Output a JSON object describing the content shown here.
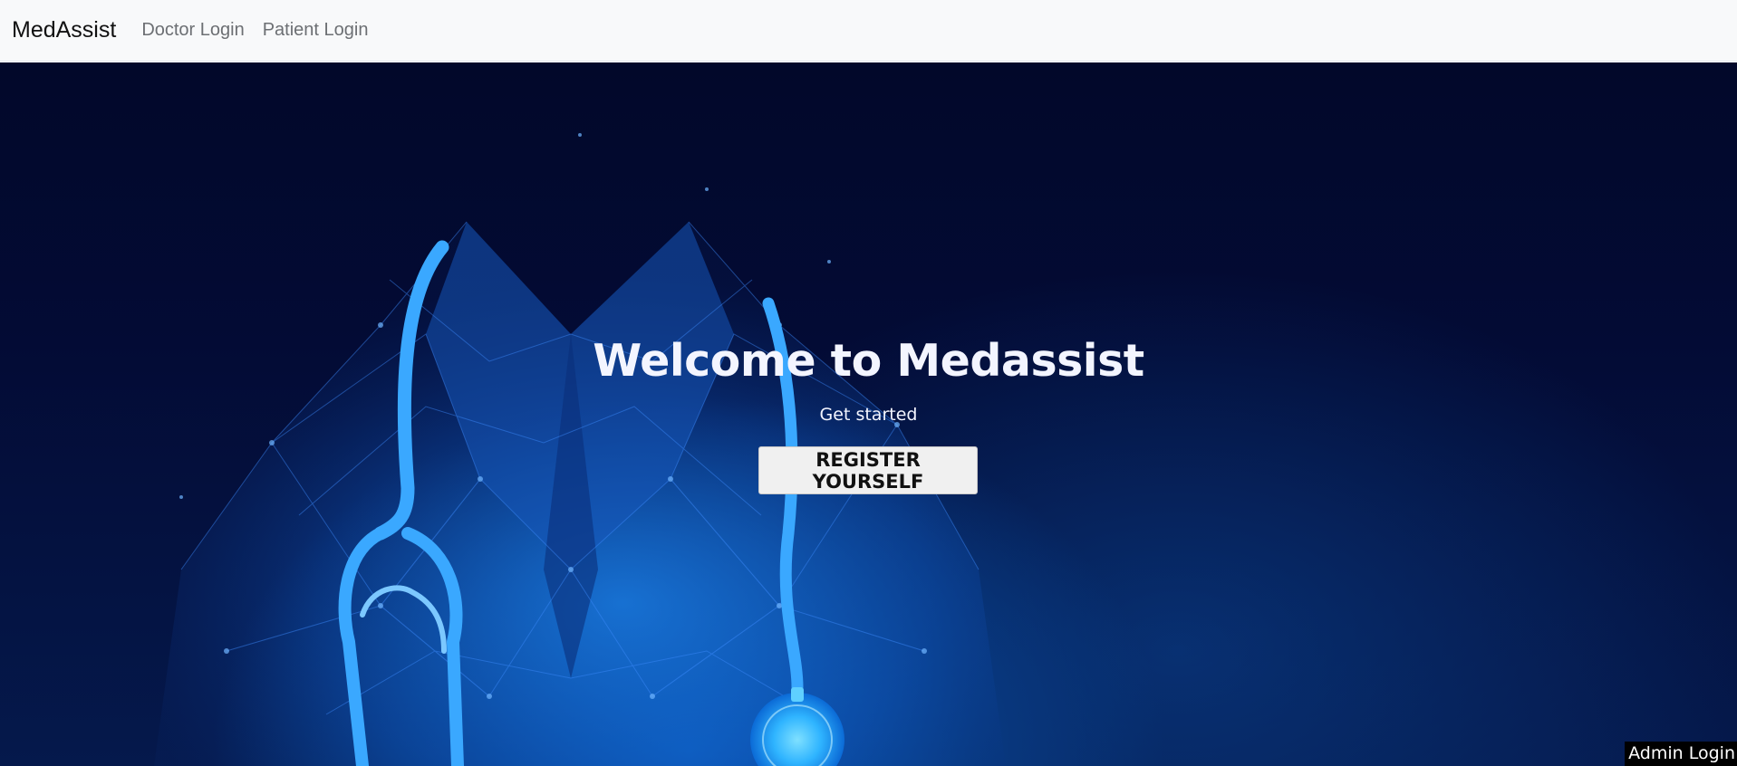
{
  "navbar": {
    "brand": "MedAssist",
    "links": [
      "Doctor Login",
      "Patient Login"
    ]
  },
  "hero": {
    "title": "Welcome to Medassist",
    "subtitle": "Get started",
    "register_label": "REGISTER YOURSELF",
    "illustration": "doctor-coat-stethoscope-icon"
  },
  "footer": {
    "admin_label": "Admin Login"
  },
  "colors": {
    "navbar_bg": "#f8f9fa",
    "hero_dark": "#02082a",
    "hero_glow": "#0b63c8",
    "accent": "#2a9cff",
    "button_bg": "#f0f0f0"
  }
}
